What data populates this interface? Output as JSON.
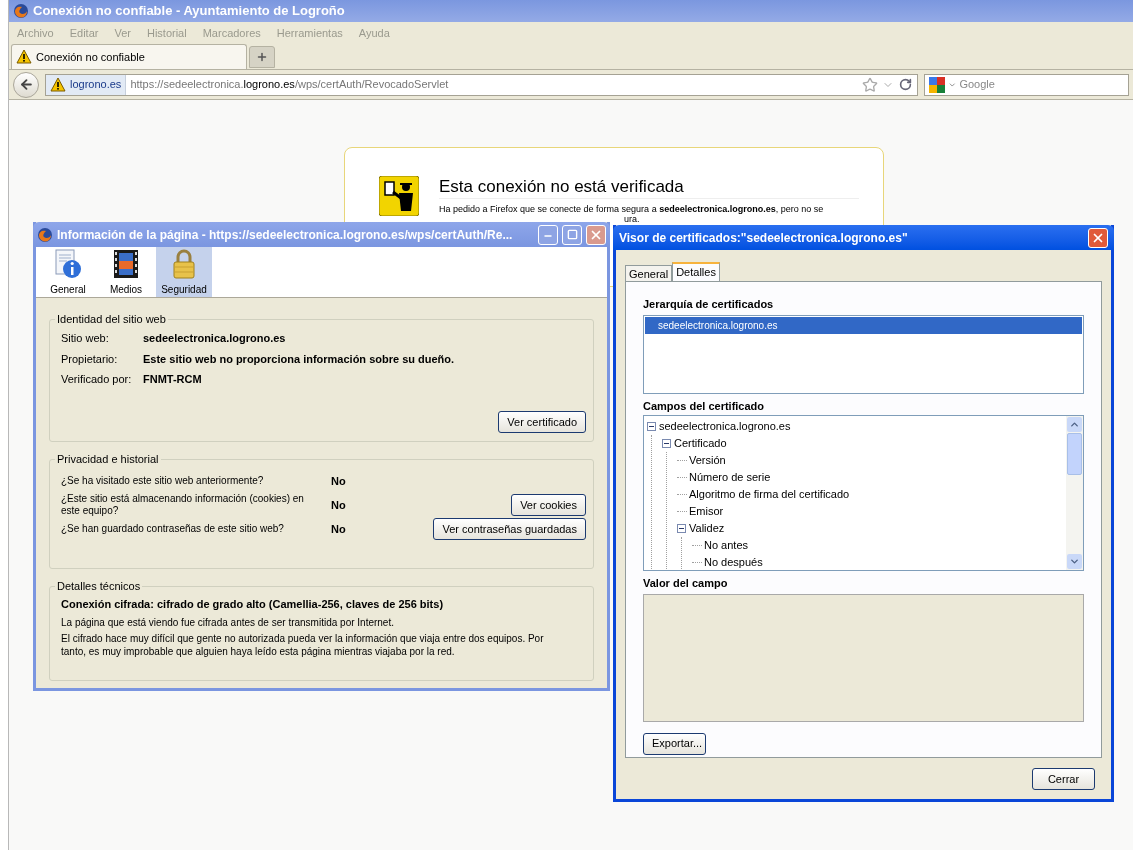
{
  "browser": {
    "title": "Conexión no confiable - Ayuntamiento de Logroño",
    "menu": [
      "Archivo",
      "Editar",
      "Ver",
      "Historial",
      "Marcadores",
      "Herramientas",
      "Ayuda"
    ],
    "tabs": [
      {
        "label": "Conexión no confiable",
        "selected": true
      }
    ],
    "identity": "logrono.es",
    "url": "https://sedeelectronica.**logrono.es**/wps/certAuth/RevocadoServlet",
    "search": {
      "placeholder": "Google"
    }
  },
  "error_page": {
    "heading": "Esta conexión no está verificada",
    "lines": [
      "Ha pedido a Firefox que se conecte de forma segura a **sedeelectronica.logrono.es**, pero no se",
      "ura."
    ]
  },
  "page_info": {
    "title": "Información de la página - https://sedeelectronica.logrono.es/wps/certAuth/Re...",
    "tabs": [
      {
        "label": "General",
        "kind": "info",
        "selected": false
      },
      {
        "label": "Medios",
        "kind": "media",
        "selected": false
      },
      {
        "label": "Seguridad",
        "kind": "lock",
        "selected": true
      }
    ],
    "identity": {
      "legend": "Identidad del sitio web",
      "rows": [
        {
          "label": "Sitio web:",
          "value": "sedeelectronica.logrono.es"
        },
        {
          "label": "Propietario:",
          "value": "Este sitio web no proporciona información sobre su dueño."
        },
        {
          "label": "Verificado por:",
          "value": "FNMT-RCM"
        }
      ],
      "button": "Ver certificado"
    },
    "privacy": {
      "legend": "Privacidad e historial",
      "rows": [
        {
          "question": "¿Se ha visitado este sitio web anteriormente?",
          "answer": "No"
        },
        {
          "question": "¿Este sitio está almacenando información (cookies) en este equipo?",
          "answer": "No",
          "button": "Ver cookies"
        },
        {
          "question": "¿Se han guardado contraseñas de este sitio web?",
          "answer": "No",
          "button": "Ver contraseñas guardadas"
        }
      ]
    },
    "technical": {
      "legend": "Detalles técnicos",
      "headline": "Conexión cifrada: cifrado de grado alto (Camellia-256, claves de 256 bits)",
      "paragraphs": [
        "La página que está viendo fue cifrada antes de ser transmitida por Internet.",
        "El cifrado hace muy difícil que gente no autorizada pueda ver la información que viaja entre dos equipos. Por tanto, es muy improbable que alguien haya leído esta página mientras viajaba por la red."
      ]
    }
  },
  "cert_viewer": {
    "title": "Visor de certificados:\"sedeelectronica.logrono.es\"",
    "tabs": [
      {
        "label": "General",
        "selected": false
      },
      {
        "label": "Detalles",
        "selected": true
      }
    ],
    "hierarchy": {
      "label": "Jerarquía de certificados",
      "items": [
        {
          "label": "sedeelectronica.logrono.es",
          "selected": true
        }
      ]
    },
    "fields": {
      "label": "Campos del certificado",
      "tree": [
        {
          "label": "sedeelectronica.logrono.es",
          "expanded": true,
          "children": [
            {
              "label": "Certificado",
              "expanded": true,
              "children": [
                {
                  "label": "Versión"
                },
                {
                  "label": "Número de serie"
                },
                {
                  "label": "Algoritmo de firma del certificado"
                },
                {
                  "label": "Emisor"
                },
                {
                  "label": "Validez",
                  "expanded": true,
                  "children": [
                    {
                      "label": "No antes"
                    },
                    {
                      "label": "No después"
                    }
                  ]
                }
              ]
            }
          ]
        }
      ]
    },
    "value": {
      "label": "Valor del campo"
    },
    "buttons": {
      "export": "Exportar...",
      "close": "Cerrar"
    }
  }
}
